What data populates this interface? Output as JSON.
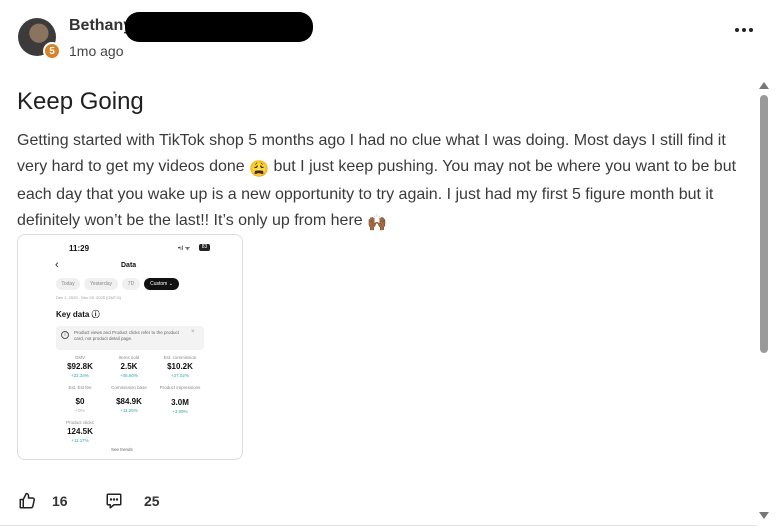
{
  "post": {
    "author": "Bethany",
    "level": "5",
    "timestamp": "1mo ago",
    "title": "Keep Going",
    "body_part1": "Getting started with TikTok shop 5 months ago I had no clue what I was doing. Most days I still find it very hard to get my videos done ",
    "emoji1": "😩",
    "body_part2": " but I just keep pushing. You may not be where you want to be but each day that you wake up is a new opportunity to try again. I just had my first 5 figure month but it definitely won’t be the last!! It’s only up from here ",
    "emoji2": "🙌🏾"
  },
  "screenshot": {
    "time": "11:29",
    "status_icons": "•ıl ᯤ",
    "battery": "83",
    "back": "‹",
    "title": "Data",
    "chips": [
      "Today",
      "Yesterday",
      "7D",
      "Custom ⌄"
    ],
    "active_chip": "Custom ⌄",
    "date_range": "Dec 1, 2025 - Dec 29, 2025 (GMT-6)",
    "key_data": "Key data ⓘ",
    "info_icon": "i",
    "info_text": "Product views and Product clicks refer to the product card, not product detail page.",
    "info_close": "×",
    "metrics": [
      {
        "label": "GMV",
        "value": "$92.8K",
        "change": "+22.34%"
      },
      {
        "label": "Items sold",
        "value": "2.5K",
        "change": "+46.60%"
      },
      {
        "label": "Est. commission",
        "value": "$10.2K",
        "change": "+27.02%"
      },
      {
        "label": "Est. Est fee",
        "value": "$0",
        "change": "+0%"
      },
      {
        "label": "Commission base",
        "value": "$84.9K",
        "change": "+11.25%"
      },
      {
        "label": "Product impressions",
        "value": "3.0M",
        "change": "+3.09%"
      },
      {
        "label": "Product clicks",
        "value": "124.5K",
        "change": "+11.17%"
      }
    ],
    "see_trends": "See trends"
  },
  "footer": {
    "like_icon": "thumbs-up-icon",
    "likes": "16",
    "comment_icon": "comment-icon",
    "comments": "25"
  },
  "menu_icon": "more-horizontal-icon"
}
